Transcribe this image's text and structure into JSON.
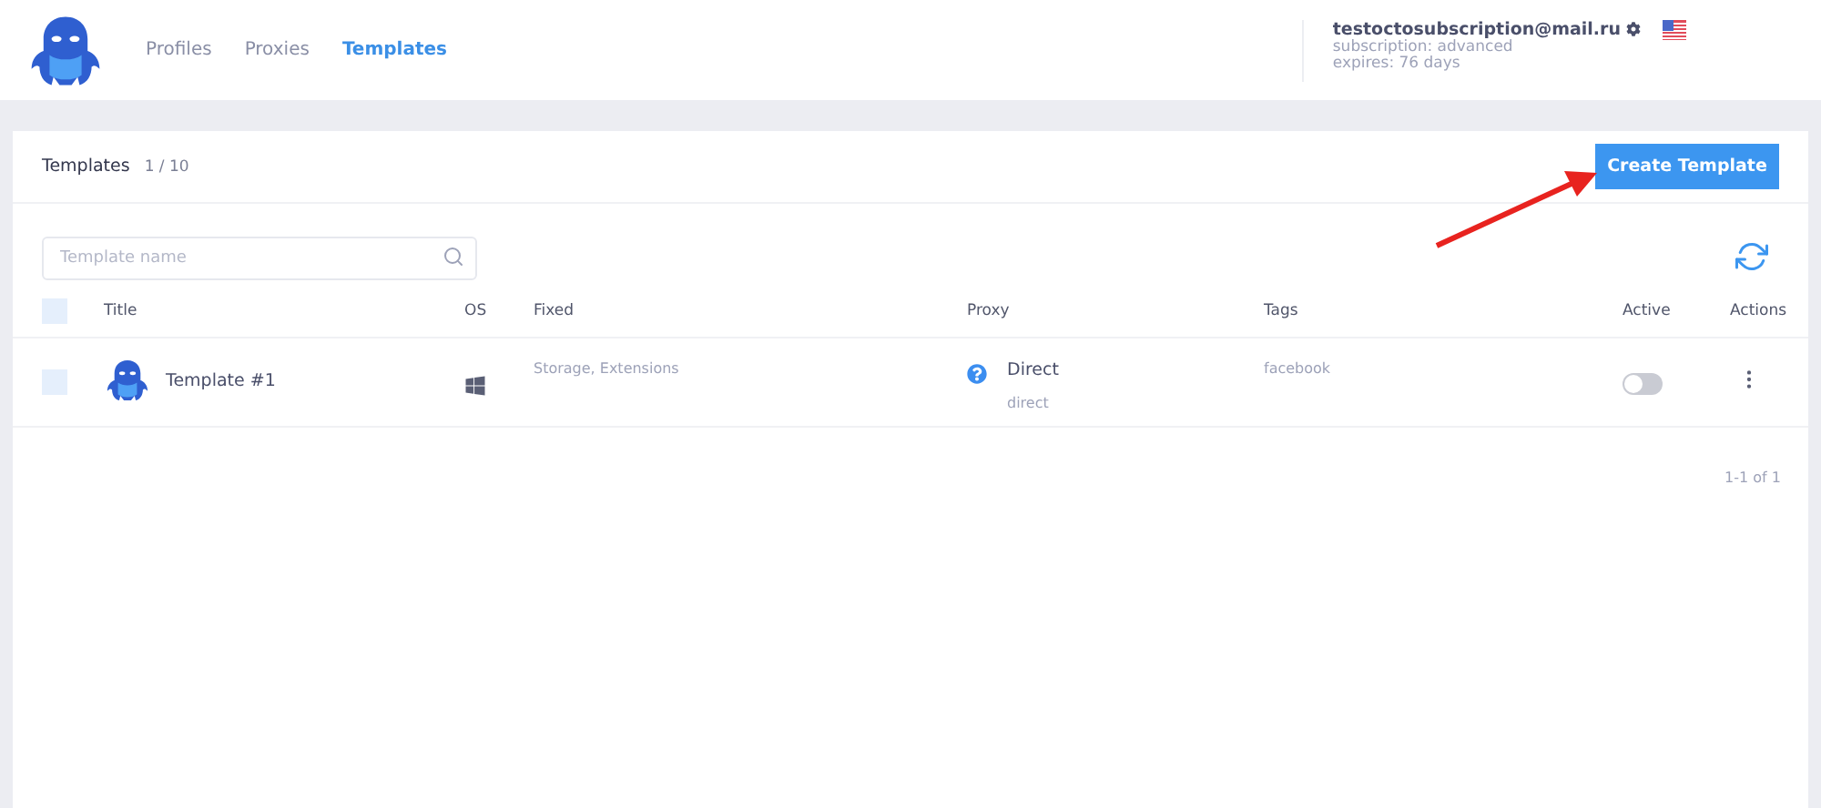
{
  "nav": {
    "tabs": [
      {
        "label": "Profiles",
        "selected": false
      },
      {
        "label": "Proxies",
        "selected": false
      },
      {
        "label": "Templates",
        "selected": true
      }
    ]
  },
  "account": {
    "email": "testoctosubscription@mail.ru",
    "subscription": "subscription: advanced",
    "expires": "expires: 76 days"
  },
  "card": {
    "title": "Templates",
    "count": "1 / 10",
    "create_button": "Create Template"
  },
  "search": {
    "placeholder": "Template name"
  },
  "table": {
    "all_checked": false,
    "columns": [
      "Title",
      "OS",
      "Fixed",
      "Proxy",
      "Tags",
      "Active",
      "Actions"
    ],
    "rows": [
      {
        "checked": false,
        "title": "Template #1",
        "os": {
          "kind": "windows"
        },
        "fixed": "Storage, Extensions",
        "proxy_name": "Direct",
        "proxy_type": "direct",
        "tags": "facebook",
        "active": false
      }
    ]
  },
  "pagination": "1-1 of 1"
}
